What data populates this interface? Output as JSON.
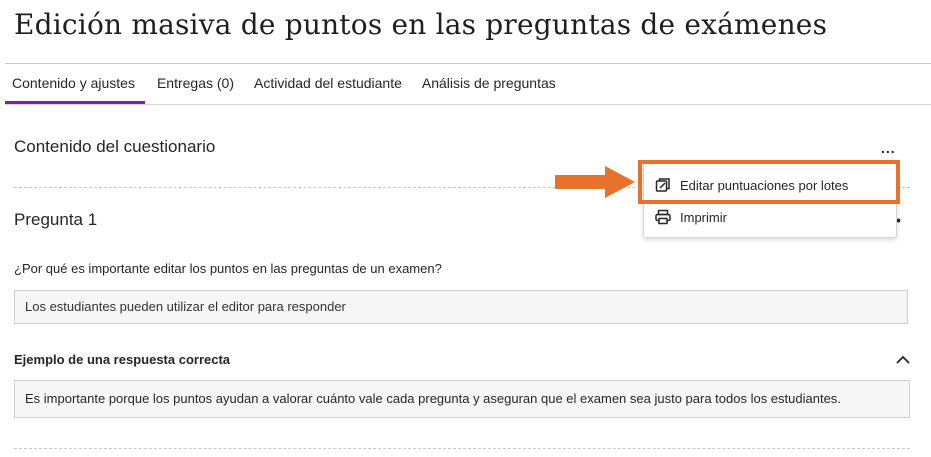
{
  "page": {
    "title": "Edición masiva de puntos en las preguntas de exámenes"
  },
  "tabs": [
    {
      "label": "Contenido y ajustes",
      "active": true
    },
    {
      "label": "Entregas (0)",
      "active": false
    },
    {
      "label": "Actividad del estudiante",
      "active": false
    },
    {
      "label": "Análisis de preguntas",
      "active": false
    }
  ],
  "section": {
    "title": "Contenido del cuestionario",
    "more_label": "..."
  },
  "menu": {
    "items": [
      {
        "label": "Editar puntuaciones por lotes",
        "icon": "edit-batch-icon"
      },
      {
        "label": "Imprimir",
        "icon": "printer-icon"
      }
    ]
  },
  "question": {
    "title": "Pregunta 1",
    "more_label": "•",
    "text": "¿Por qué es importante editar los puntos en las preguntas de un examen?",
    "answer_placeholder": "Los estudiantes pueden utilizar el editor para responder"
  },
  "example": {
    "title": "Ejemplo de una respuesta correcta",
    "text": "Es importante porque los puntos ayudan a valorar cuánto vale cada pregunta y aseguran que el examen sea justo para todos los estudiantes."
  },
  "colors": {
    "accent_tab": "#8b1aa6",
    "highlight": "#e8712c"
  }
}
